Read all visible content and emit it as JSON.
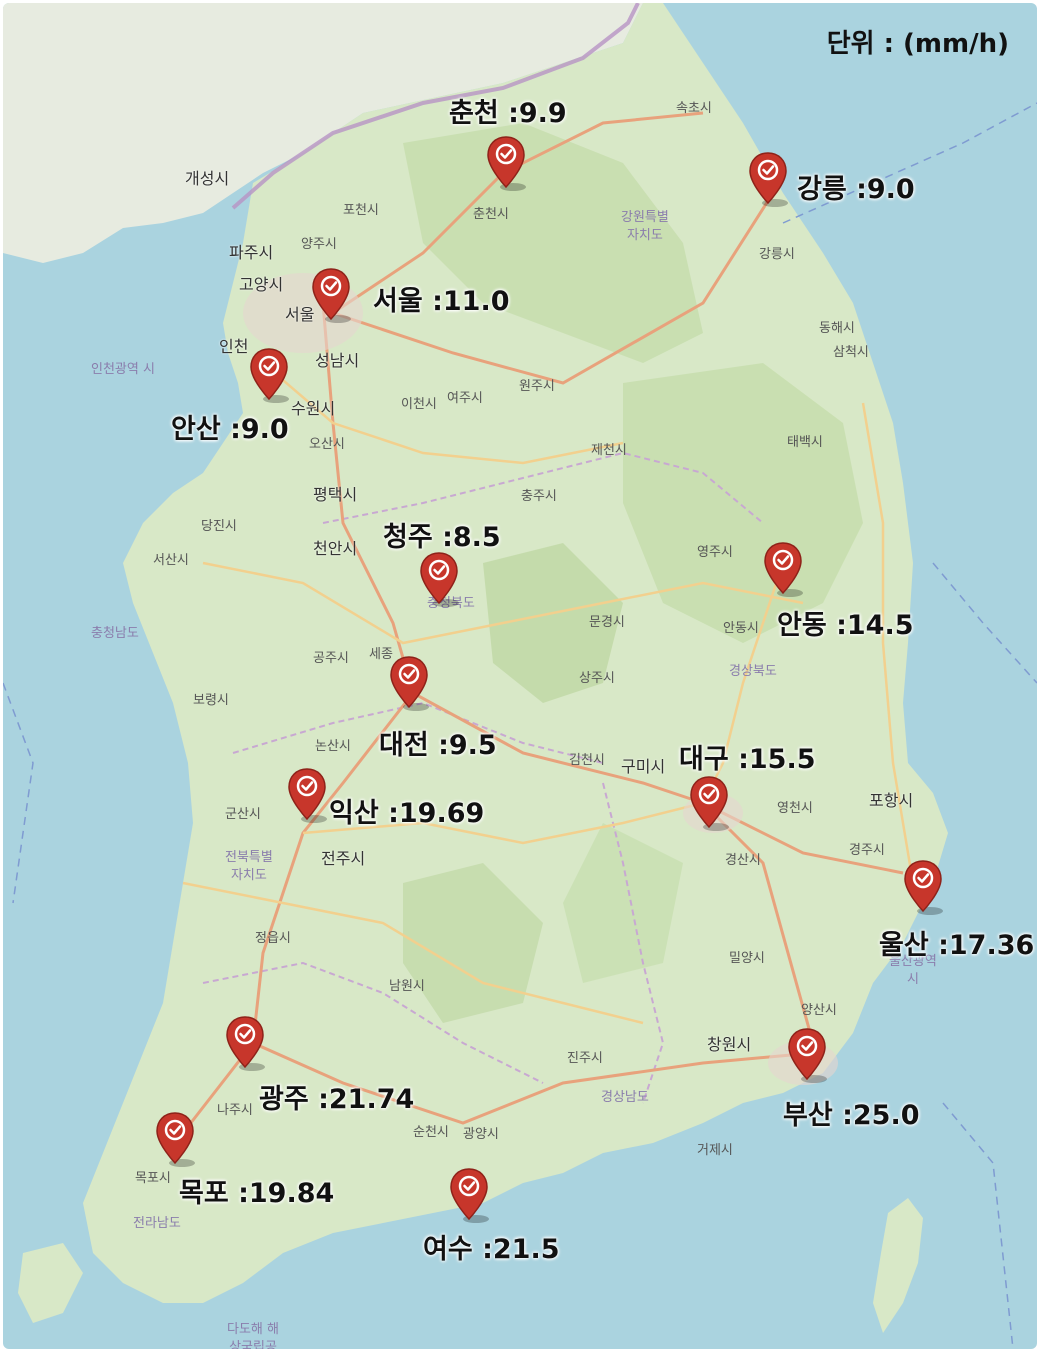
{
  "unit_label": "단위 : (mm/h)",
  "colors": {
    "sea": "#aad3df",
    "land": "#d8e8c7",
    "land_south": "#e9ece0",
    "forest": "#b9d49e",
    "road_major": "#e8a27c",
    "road_minor": "#f2d08e",
    "border": "#b894c4",
    "pin": "#c7362b"
  },
  "markers": [
    {
      "id": "chuncheon",
      "label": "춘천 :9.9",
      "value": 9.9
    },
    {
      "id": "gangneung",
      "label": "강릉 :9.0",
      "value": 9.0
    },
    {
      "id": "seoul",
      "label": "서울 :11.0",
      "value": 11.0
    },
    {
      "id": "ansan",
      "label": "안산 :9.0",
      "value": 9.0
    },
    {
      "id": "cheongju",
      "label": "청주 :8.5",
      "value": 8.5
    },
    {
      "id": "andong",
      "label": "안동 :14.5",
      "value": 14.5
    },
    {
      "id": "daejeon",
      "label": "대전 :9.5",
      "value": 9.5
    },
    {
      "id": "daegu",
      "label": "대구 :15.5",
      "value": 15.5
    },
    {
      "id": "iksan",
      "label": "익산 :19.69",
      "value": 19.69
    },
    {
      "id": "ulsan",
      "label": "울산 :17.36",
      "value": 17.36
    },
    {
      "id": "gwangju",
      "label": "광주 :21.74",
      "value": 21.74
    },
    {
      "id": "busan",
      "label": "부산 :25.0",
      "value": 25.0
    },
    {
      "id": "mokpo",
      "label": "목포 :19.84",
      "value": 19.84
    },
    {
      "id": "yeosu",
      "label": "여수 :21.5",
      "value": 21.5
    }
  ],
  "map_labels": {
    "kaesong": "개성시",
    "sokcho": "속초시",
    "pocheon": "포천시",
    "chuncheon_si": "춘천시",
    "paju": "파주시",
    "yangju": "양주시",
    "goyang": "고양시",
    "seoul_base": "서울",
    "incheon": "인천",
    "incheon_metro": "인천광역\n시",
    "seongnam": "성남시",
    "suwon": "수원시",
    "osan": "오산시",
    "icheon": "이천시",
    "yeoju": "여주시",
    "wonju": "원주시",
    "gangwon": "강원특별\n자치도",
    "gangneung_si": "강릉시",
    "donghae": "동해시",
    "samcheok": "삼척시",
    "taebaek": "태백시",
    "jecheon": "제천시",
    "chungju": "충주시",
    "pyeongtaek": "평택시",
    "dangjin": "당진시",
    "seosan": "서산시",
    "cheonan": "천안시",
    "chungnam": "충청남도",
    "chungbuk": "충청북도",
    "yeongju": "영주시",
    "mungyeong": "문경시",
    "andong_si": "안동시",
    "gyeongbuk": "경상북도",
    "gongju": "공주시",
    "sejong": "세종",
    "boryeong": "보령시",
    "sangju": "상주시",
    "nonsan": "논산시",
    "gimcheon": "김천시",
    "gumi": "구미시",
    "gunsan": "군산시",
    "jeonbuk": "전북특별\n자치도",
    "jeonju": "전주시",
    "yeongcheon": "영천시",
    "pohang": "포항시",
    "gyeongju": "경주시",
    "gyeongsan": "경산시",
    "jeongeup": "정읍시",
    "miryang": "밀양시",
    "ulsan_metro": "울산광역\n시",
    "namwon": "남원시",
    "yangsan": "양산시",
    "changwon": "창원시",
    "jinju": "진주시",
    "gyeongnam": "경상남도",
    "naju": "나주시",
    "suncheon": "순천시",
    "gwangyang": "광양시",
    "geoje": "거제시",
    "mokpo_si": "목포시",
    "jeonnam": "전라남도",
    "dadohae": "다도해 해\n상국립공"
  }
}
